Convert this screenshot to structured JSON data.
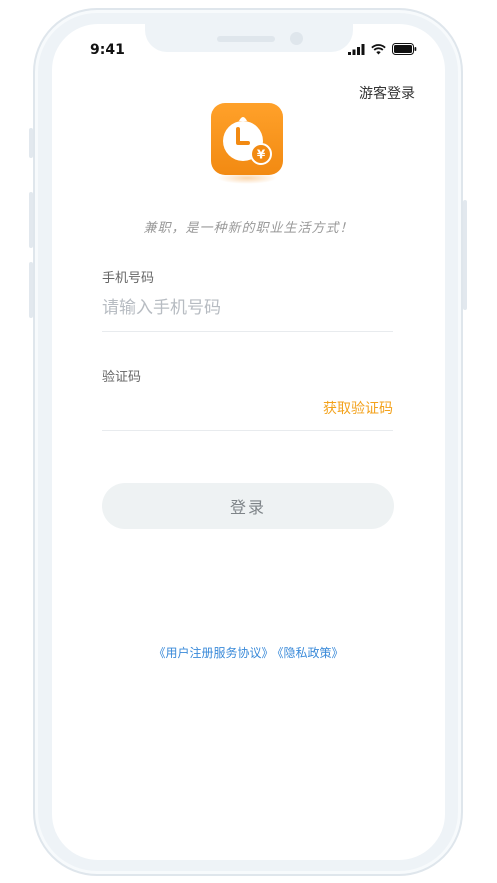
{
  "status_bar": {
    "time": "9:41",
    "icons": [
      "signal-icon",
      "wifi-icon",
      "battery-icon"
    ]
  },
  "header": {
    "guest_login": "游客登录"
  },
  "brand": {
    "slogan": "兼职，是一种新的职业生活方式！",
    "logo_icon": "clock-yuan-icon",
    "colors": {
      "logo_top": "#ffa12a",
      "logo_bottom": "#f28a12",
      "accent": "#f3a21c",
      "link": "#3a8ad9"
    }
  },
  "form": {
    "phone_label": "手机号码",
    "phone_placeholder": "请输入手机号码",
    "phone_value": "",
    "code_label": "验证码",
    "code_value": "",
    "get_code": "获取验证码",
    "login_button": "登录"
  },
  "agreements": {
    "user_agreement": "《用户注册服务协议》",
    "privacy_policy": "《隐私政策》"
  }
}
